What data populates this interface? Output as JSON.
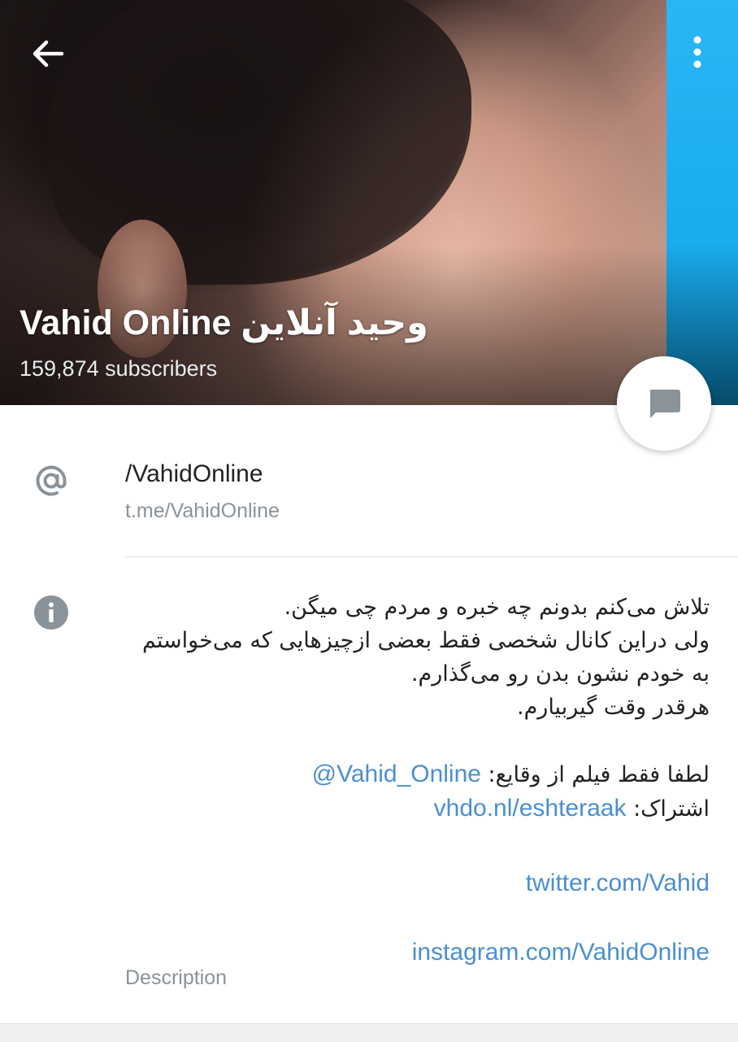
{
  "header": {
    "title": "Vahid Online وحید آنلاین",
    "subscribers": "159,874 subscribers",
    "back_icon": "arrow-left-icon",
    "menu_icon": "more-vertical-icon",
    "fab_icon": "message-icon"
  },
  "username_row": {
    "value": "/VahidOnline",
    "sublabel": "t.me/VahidOnline",
    "icon": "at-sign-icon"
  },
  "description_row": {
    "icon": "info-icon",
    "lines": [
      "تلاش می‌کنم بدونم چه خبره و مردم چی میگن.",
      "ولی دراین کانال شخصی فقط بعضی ازچیزهایی که می‌خواستم",
      "به خودم نشون بدن رو می‌گذارم.",
      "هرقدر وقت گیربیارم."
    ],
    "videos_prefix": "لطفا فقط فیلم از وقایع: ",
    "videos_link": "@Vahid_Online",
    "subscription_prefix": "اشتراک: ",
    "subscription_link": "vhdo.nl/eshteraak",
    "twitter_link": "twitter.com/Vahid",
    "instagram_link": "instagram.com/VahidOnline",
    "label": "Description"
  },
  "colors": {
    "accent_link": "#4a8fd0",
    "side_blue": "#1ea8ec",
    "icon_gray": "#8a9399"
  }
}
